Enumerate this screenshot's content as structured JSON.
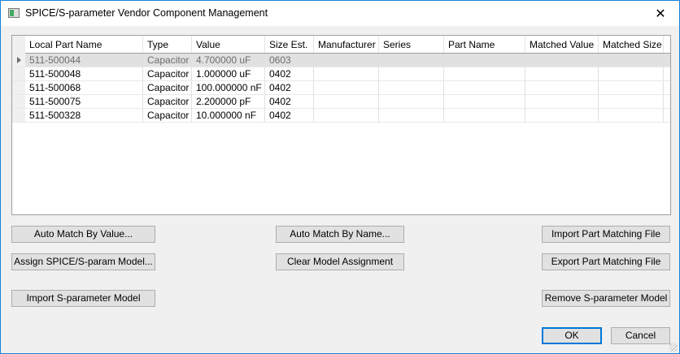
{
  "window": {
    "title": "SPICE/S-parameter Vendor Component Management",
    "close_icon": "close-icon"
  },
  "table": {
    "columns": [
      "Local Part Name",
      "Type",
      "Value",
      "Size Est.",
      "Manufacturer",
      "Series",
      "Part Name",
      "Matched Value",
      "Matched Size"
    ],
    "rows": [
      [
        "511-500044",
        "Capacitor",
        "4.700000 uF",
        "0603",
        "",
        "",
        "",
        "",
        ""
      ],
      [
        "511-500048",
        "Capacitor",
        "1.000000 uF",
        "0402",
        "",
        "",
        "",
        "",
        ""
      ],
      [
        "511-500068",
        "Capacitor",
        "100.000000 nF",
        "0402",
        "",
        "",
        "",
        "",
        ""
      ],
      [
        "511-500075",
        "Capacitor",
        "2.200000 pF",
        "0402",
        "",
        "",
        "",
        "",
        ""
      ],
      [
        "511-500328",
        "Capacitor",
        "10.000000 nF",
        "0402",
        "",
        "",
        "",
        "",
        ""
      ]
    ],
    "selected_row": 0
  },
  "buttons": {
    "auto_match_value": "Auto Match By Value...",
    "assign_model": "Assign SPICE/S-param Model...",
    "import_sparam": "Import S-parameter Model",
    "auto_match_name": "Auto Match By Name...",
    "clear_assignment": "Clear Model Assignment",
    "import_matching": "Import Part Matching File",
    "export_matching": "Export Part Matching File",
    "remove_sparam": "Remove S-parameter Model",
    "ok": "OK",
    "cancel": "Cancel"
  },
  "colors": {
    "accent": "#0078d7",
    "selected_row": "#e1e1e1"
  }
}
